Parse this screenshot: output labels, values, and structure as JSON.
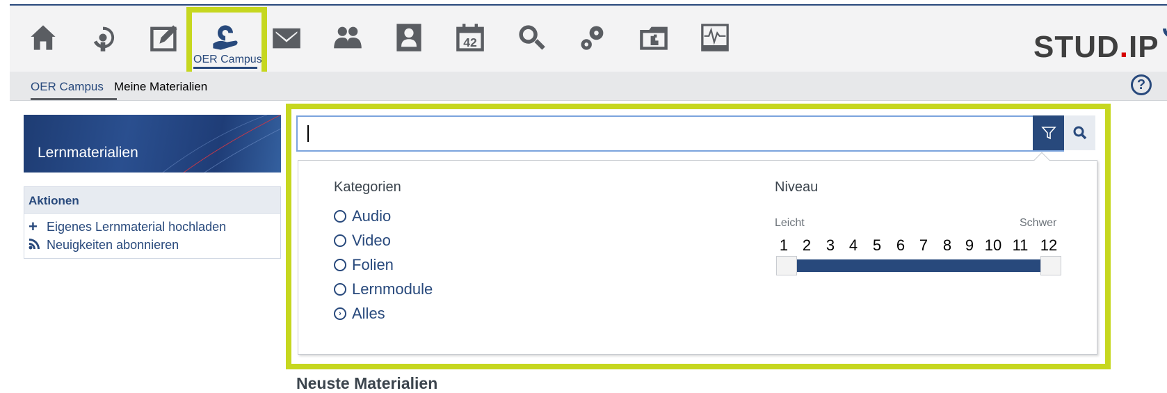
{
  "header": {
    "icons": [
      {
        "name": "home-icon"
      },
      {
        "name": "courses-icon"
      },
      {
        "name": "workplace-icon"
      },
      {
        "name": "oer-campus-icon"
      },
      {
        "name": "messages-icon"
      },
      {
        "name": "community-icon"
      },
      {
        "name": "profile-icon"
      },
      {
        "name": "calendar-icon"
      },
      {
        "name": "search-icon"
      },
      {
        "name": "tools-icon"
      },
      {
        "name": "files-icon"
      },
      {
        "name": "monitor-icon"
      }
    ],
    "active_label": "OER Campus",
    "logo_text": "STUD",
    "logo_dot": ".",
    "logo_text2": "IP"
  },
  "subnav": {
    "tabs": [
      {
        "label": "OER Campus",
        "active": true
      },
      {
        "label": "Meine Materialien",
        "active": false
      }
    ],
    "help_label": "?"
  },
  "sidebar": {
    "title": "Lernmaterialien",
    "actions_heading": "Aktionen",
    "actions": [
      {
        "icon": "plus-icon",
        "label": "Eigenes Lernmaterial hochladen"
      },
      {
        "icon": "rss-icon",
        "label": "Neuigkeiten abonnieren"
      }
    ]
  },
  "search": {
    "value": "",
    "filter_icon": "filter-icon",
    "search_icon": "magnifier-icon"
  },
  "filters": {
    "categories_title": "Kategorien",
    "categories": [
      {
        "label": "Audio",
        "selected": false
      },
      {
        "label": "Video",
        "selected": false
      },
      {
        "label": "Folien",
        "selected": false
      },
      {
        "label": "Lernmodule",
        "selected": false
      },
      {
        "label": "Alles",
        "selected": true
      }
    ],
    "level_title": "Niveau",
    "level_min_label": "Leicht",
    "level_max_label": "Schwer",
    "levels": [
      "1",
      "2",
      "3",
      "4",
      "5",
      "6",
      "7",
      "8",
      "9",
      "10",
      "11",
      "12"
    ],
    "level_range": [
      1,
      12
    ]
  },
  "main": {
    "newest_title": "Neuste Materialien"
  },
  "colors": {
    "primary": "#28497c",
    "highlight": "#c6d71f",
    "nav_bg": "#f3f3f4"
  }
}
